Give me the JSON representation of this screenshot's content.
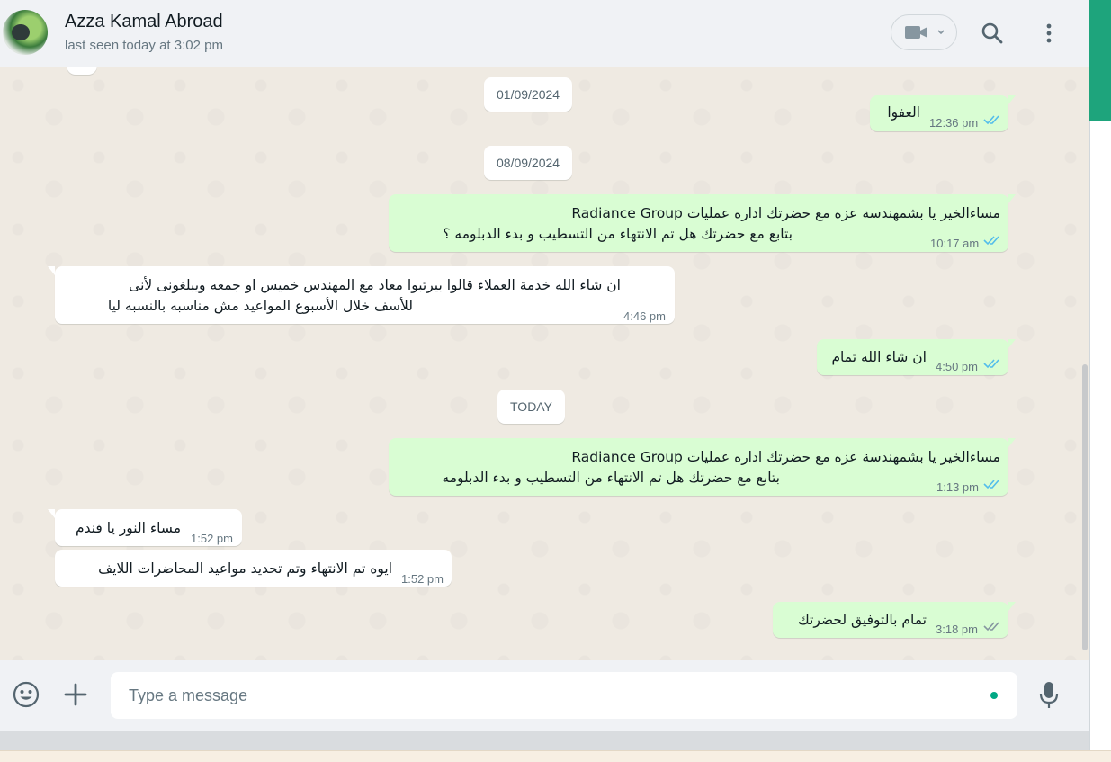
{
  "contact": {
    "name": "Azza Kamal Abroad",
    "status": "last seen today at 3:02 pm"
  },
  "header_icons": {
    "video": "video-call-icon",
    "search": "search-icon",
    "menu": "menu-icon"
  },
  "chat": {
    "dates": [
      "01/09/2024",
      "08/09/2024",
      "TODAY"
    ],
    "messages": [
      {
        "direction": "out",
        "lines": [
          "العفوا"
        ],
        "time": "12:36 pm",
        "status": "read"
      },
      {
        "direction": "out",
        "lines": [
          "مساءالخير يا بشمهندسة  عزه مع  حضرتك اداره عمليات Radiance Group",
          "بتابع مع حضرتك هل تم الانتهاء من التسطيب و بدء الدبلومه ؟"
        ],
        "time": "10:17 am",
        "status": "read"
      },
      {
        "direction": "in",
        "lines": [
          "ان شاء الله خدمة العملاء قالوا بيرتبوا معاد مع المهندس خميس او جمعه ويبلغونى لأنى",
          "للأسف خلال الأسبوع المواعيد مش مناسبه بالنسبه ليا"
        ],
        "time": "4:46 pm"
      },
      {
        "direction": "out",
        "lines": [
          "ان شاء الله تمام"
        ],
        "time": "4:50 pm",
        "status": "read"
      },
      {
        "direction": "out",
        "lines": [
          "مساءالخير يا بشمهندسة  عزه مع  حضرتك اداره عمليات Radiance Group",
          "بتابع مع حضرتك هل تم الانتهاء من التسطيب و بدء الدبلومه"
        ],
        "time": "1:13 pm",
        "status": "read"
      },
      {
        "direction": "in",
        "lines": [
          "مساء النور يا فندم"
        ],
        "time": "1:52 pm"
      },
      {
        "direction": "in",
        "lines": [
          "ايوه تم الانتهاء وتم تحديد مواعيد المحاضرات اللايف"
        ],
        "time": "1:52 pm"
      },
      {
        "direction": "out",
        "lines": [
          "تمام بالتوفيق لحضرتك"
        ],
        "time": "3:18 pm",
        "status": "delivered"
      }
    ]
  },
  "composer": {
    "placeholder": "Type a message",
    "value": "",
    "emoji_icon": "emoji-icon",
    "attach_icon": "plus-icon",
    "mic_icon": "mic-icon"
  },
  "colors": {
    "outgoing_bubble": "#d9fdd3",
    "incoming_bubble": "#ffffff",
    "chat_background": "#efeae2",
    "read_tick": "#53bdeb",
    "delivered_tick": "#8696a0",
    "accent": "#00a884"
  }
}
